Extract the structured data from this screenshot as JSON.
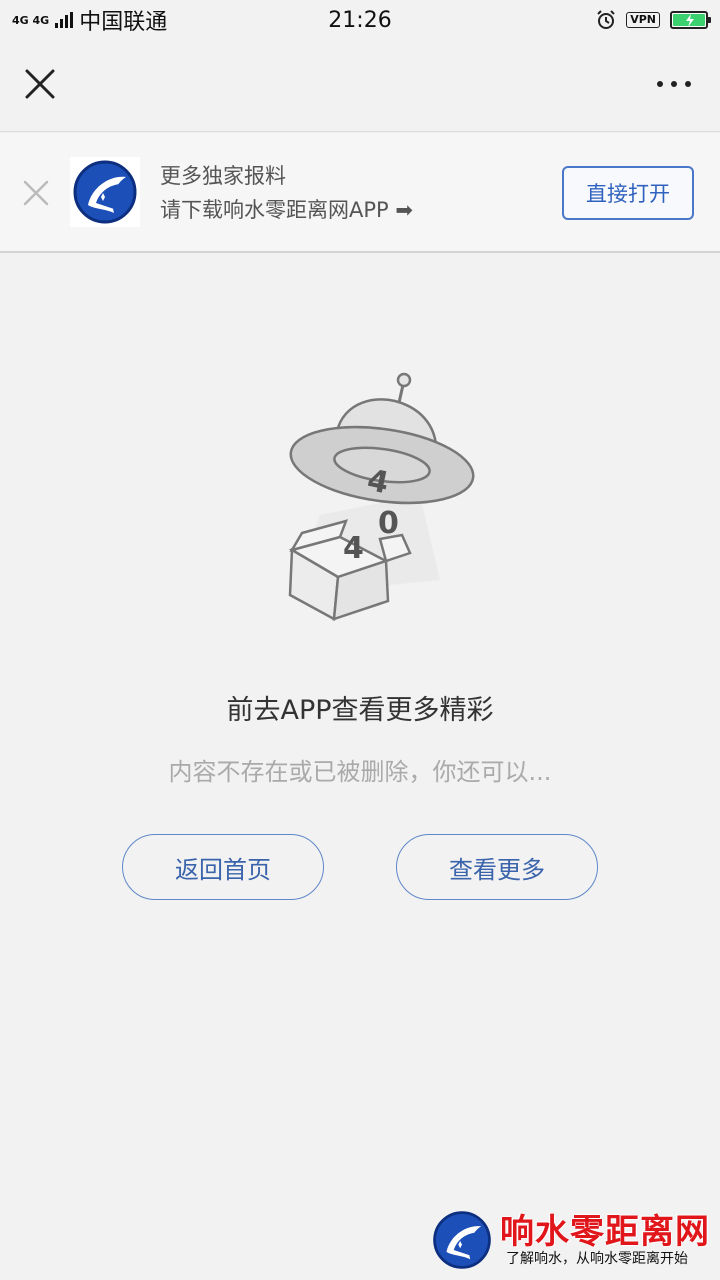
{
  "status_bar": {
    "network": "4G 4G",
    "carrier": "中国联通",
    "time": "21:26",
    "vpn": "VPN"
  },
  "navbar": {
    "close_icon": "close-icon",
    "more_icon": "more-dots-icon"
  },
  "banner": {
    "line1": "更多独家报料",
    "line2": "请下载响水零距离网APP ➡",
    "open_button": "直接打开"
  },
  "error_page": {
    "illustration_digits": [
      "4",
      "0",
      "4"
    ],
    "title": "前去APP查看更多精彩",
    "subtitle": "内容不存在或已被删除，你还可以...",
    "home_button": "返回首页",
    "more_button": "查看更多"
  },
  "watermark": {
    "title": "响水零距离网",
    "subtitle": "了解响水，从响水零距离开始"
  },
  "colors": {
    "accent": "#3a64ab",
    "watermark_red": "#e0161b",
    "battery_green": "#3bd16f"
  }
}
